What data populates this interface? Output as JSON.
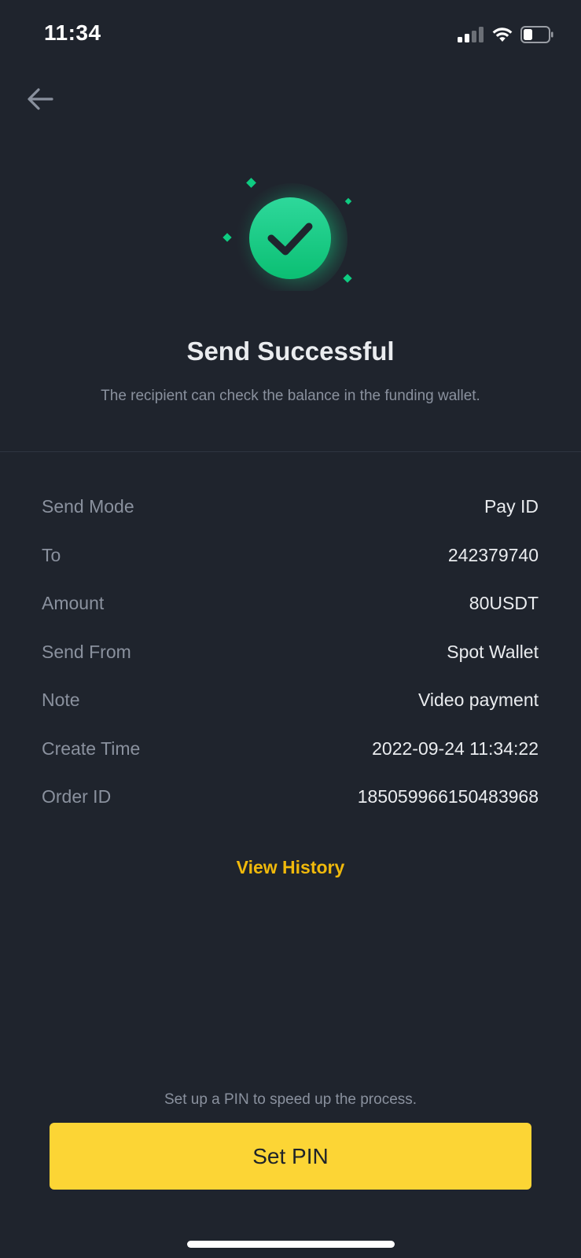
{
  "status_bar": {
    "time": "11:34"
  },
  "header": {
    "back_icon": "arrow-left-icon"
  },
  "result": {
    "icon": "check-circle-icon",
    "title": "Send Successful",
    "subtitle": "The recipient can check the balance in the funding wallet."
  },
  "details": [
    {
      "label": "Send Mode",
      "value": "Pay ID"
    },
    {
      "label": "To",
      "value": "242379740"
    },
    {
      "label": "Amount",
      "value": "80USDT"
    },
    {
      "label": "Send From",
      "value": "Spot Wallet"
    },
    {
      "label": "Note",
      "value": "Video payment"
    },
    {
      "label": "Create Time",
      "value": "2022-09-24 11:34:22"
    },
    {
      "label": "Order ID",
      "value": "185059966150483968"
    }
  ],
  "actions": {
    "view_history": "View History",
    "pin_hint": "Set up a PIN to speed up the process.",
    "set_pin": "Set PIN"
  },
  "colors": {
    "background": "#1f242d",
    "accent": "#f0b90b",
    "button": "#fcd535",
    "success": "#0ecb81"
  }
}
